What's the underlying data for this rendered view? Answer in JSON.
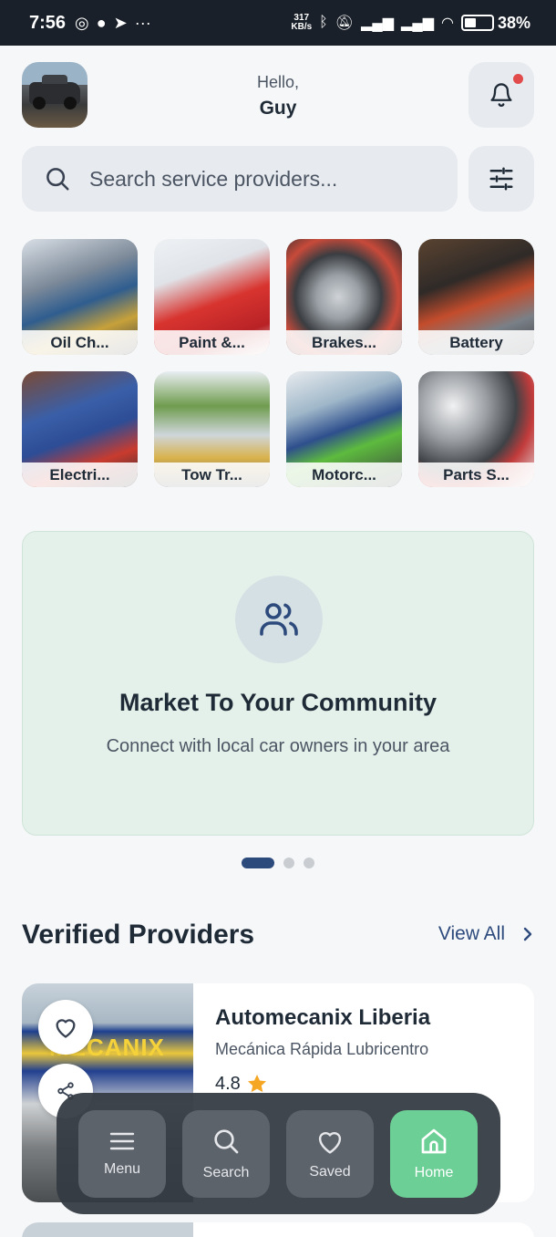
{
  "status_bar": {
    "time": "7:56",
    "net_speed_value": "317",
    "net_speed_unit": "KB/s",
    "battery": "38%"
  },
  "header": {
    "hello": "Hello,",
    "name": "Guy"
  },
  "search": {
    "placeholder": "Search service providers..."
  },
  "categories": [
    {
      "label": "Oil Ch..."
    },
    {
      "label": "Paint &..."
    },
    {
      "label": "Brakes..."
    },
    {
      "label": "Battery"
    },
    {
      "label": "Electri..."
    },
    {
      "label": "Tow Tr..."
    },
    {
      "label": "Motorc..."
    },
    {
      "label": "Parts S..."
    }
  ],
  "banner": {
    "title": "Market To Your Community",
    "subtitle": "Connect with local car owners in your area",
    "page_index": 1,
    "page_count": 3
  },
  "verified": {
    "title": "Verified Providers",
    "view_all": "View All"
  },
  "providers": [
    {
      "name": "Automecanix Liberia",
      "subtitle": "Mecánica Rápida Lubricentro",
      "rating": "4.8",
      "sign_text": "MECANIX"
    }
  ],
  "nav": {
    "menu": "Menu",
    "search": "Search",
    "saved": "Saved",
    "home": "Home"
  },
  "colors": {
    "accent": "#2d4a7d",
    "active_nav": "#6ccf96",
    "banner_bg": "#e4f1ea",
    "notification_dot": "#e24b4b",
    "star": "#f5a623"
  }
}
